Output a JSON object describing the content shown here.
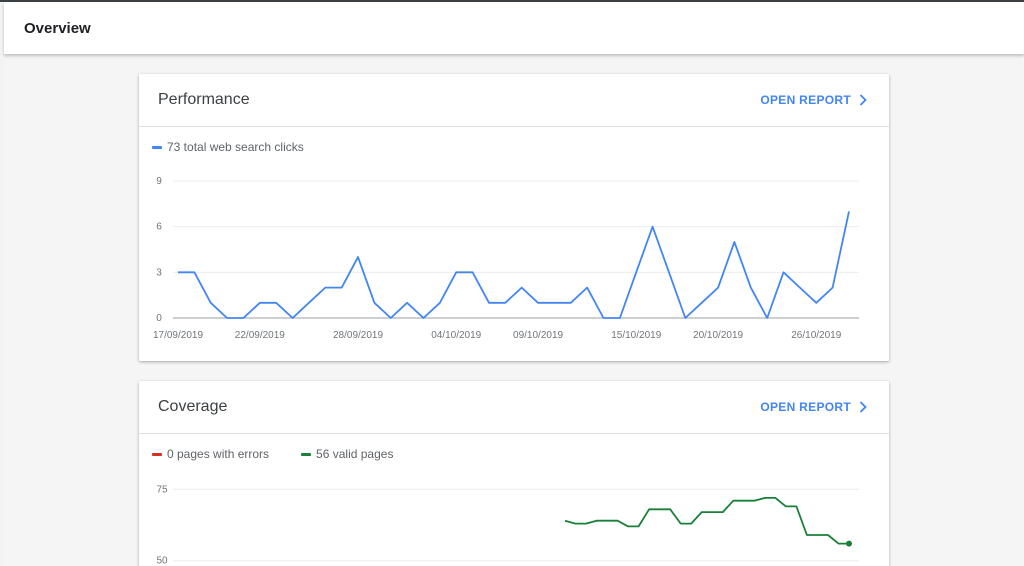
{
  "appbar": {
    "title": "Overview"
  },
  "colors": {
    "clicks": "#4285f4",
    "errors": "#d93025",
    "valid": "#188038",
    "grid": "#ececec",
    "axis": "#9aa0a6"
  },
  "performance": {
    "title": "Performance",
    "open_report": "OPEN REPORT",
    "legend": [
      {
        "label": "73 total web search clicks",
        "color": "#4285f4"
      }
    ]
  },
  "coverage": {
    "title": "Coverage",
    "open_report": "OPEN REPORT",
    "legend": [
      {
        "label": "0 pages with errors",
        "color": "#d93025"
      },
      {
        "label": "56 valid pages",
        "color": "#188038"
      }
    ]
  },
  "chart_data": [
    {
      "type": "line",
      "x_tick_labels": [
        "17/09/2019",
        "22/09/2019",
        "28/09/2019",
        "04/10/2019",
        "09/10/2019",
        "15/10/2019",
        "20/10/2019",
        "26/10/2019"
      ],
      "x_tick_index": [
        0,
        5,
        11,
        17,
        22,
        28,
        33,
        39
      ],
      "y_ticks": [
        0,
        3,
        6,
        9
      ],
      "ylim": [
        0,
        9
      ],
      "series": [
        {
          "name": "73 total web search clicks",
          "color": "#4285f4",
          "values": [
            3,
            3,
            1,
            0,
            0,
            1,
            1,
            0,
            1,
            2,
            2,
            4,
            1,
            0,
            1,
            0,
            1,
            3,
            3,
            1,
            1,
            2,
            1,
            1,
            1,
            2,
            0,
            0,
            3,
            6,
            3,
            0,
            1,
            2,
            5,
            2,
            0,
            3,
            2,
            1,
            2,
            7
          ]
        }
      ]
    },
    {
      "type": "line",
      "y_ticks": [
        50,
        75
      ],
      "ylim": [
        45,
        80
      ],
      "series": [
        {
          "name": "56 valid pages",
          "color": "#188038",
          "values": [
            64,
            63,
            63,
            64,
            64,
            64,
            62,
            62,
            68,
            68,
            68,
            63,
            63,
            67,
            67,
            67,
            71,
            71,
            71,
            72,
            72,
            69,
            69,
            59,
            59,
            59,
            56,
            56
          ]
        }
      ]
    }
  ]
}
